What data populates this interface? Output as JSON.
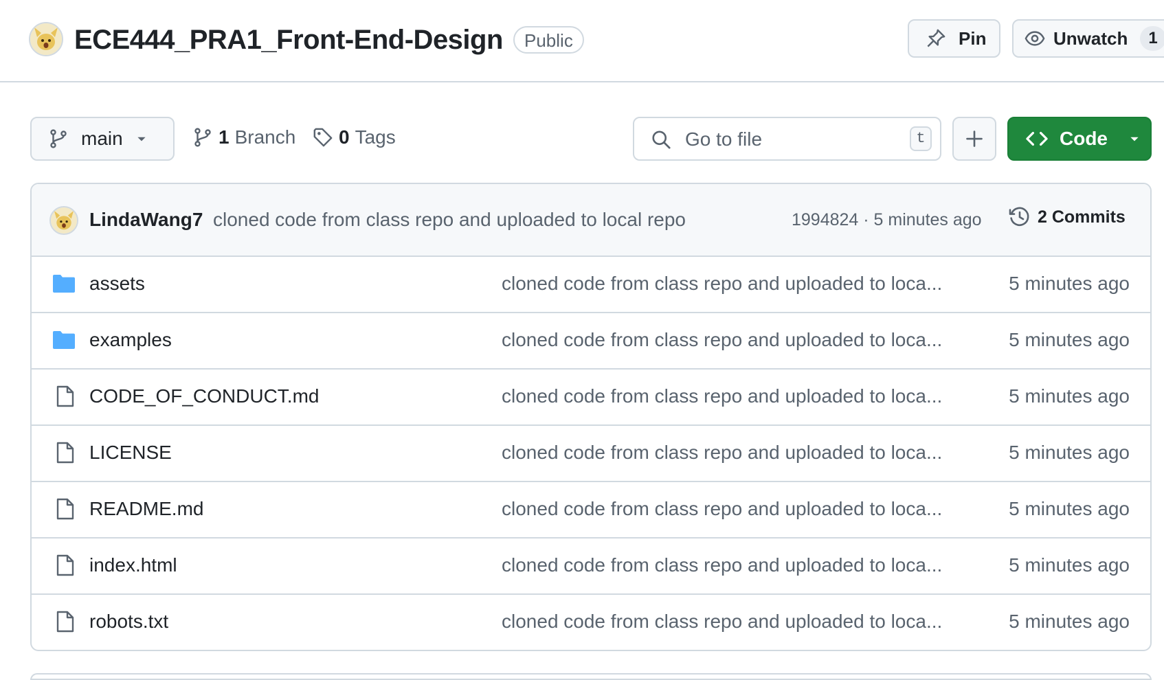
{
  "repo": {
    "name": "ECE444_PRA1_Front-End-Design",
    "visibility": "Public"
  },
  "actions": {
    "pin_label": "Pin",
    "unwatch_label": "Unwatch",
    "watch_count": "1"
  },
  "toolbar": {
    "branch": "main",
    "branch_count": "1",
    "branch_label": "Branch",
    "tag_count": "0",
    "tag_label": "Tags",
    "search_placeholder": "Go to file",
    "search_shortcut": "t",
    "code_label": "Code"
  },
  "latest_commit": {
    "author": "LindaWang7",
    "message": "cloned code from class repo and uploaded to local repo",
    "meta": "1994824 · 5 minutes ago",
    "commits_label": "2 Commits"
  },
  "files": [
    {
      "name": "assets",
      "type": "folder",
      "message": "cloned code from class repo and uploaded to loca...",
      "date": "5 minutes ago"
    },
    {
      "name": "examples",
      "type": "folder",
      "message": "cloned code from class repo and uploaded to loca...",
      "date": "5 minutes ago"
    },
    {
      "name": "CODE_OF_CONDUCT.md",
      "type": "file",
      "message": "cloned code from class repo and uploaded to loca...",
      "date": "5 minutes ago"
    },
    {
      "name": "LICENSE",
      "type": "file",
      "message": "cloned code from class repo and uploaded to loca...",
      "date": "5 minutes ago"
    },
    {
      "name": "README.md",
      "type": "file",
      "message": "cloned code from class repo and uploaded to loca...",
      "date": "5 minutes ago"
    },
    {
      "name": "index.html",
      "type": "file",
      "message": "cloned code from class repo and uploaded to loca...",
      "date": "5 minutes ago"
    },
    {
      "name": "robots.txt",
      "type": "file",
      "message": "cloned code from class repo and uploaded to loca...",
      "date": "5 minutes ago"
    }
  ],
  "colors": {
    "accent_green": "#1f883d",
    "folder_blue": "#54aeff",
    "border": "#d1d9e0",
    "muted_text": "#59636e"
  },
  "icons": {
    "pin": "pin-icon",
    "watch": "eye-icon",
    "branch": "git-branch-icon",
    "tag": "tag-icon",
    "search": "search-icon",
    "plus": "plus-icon",
    "code": "code-icon",
    "history": "history-icon",
    "folder": "folder-icon",
    "file": "file-icon"
  }
}
